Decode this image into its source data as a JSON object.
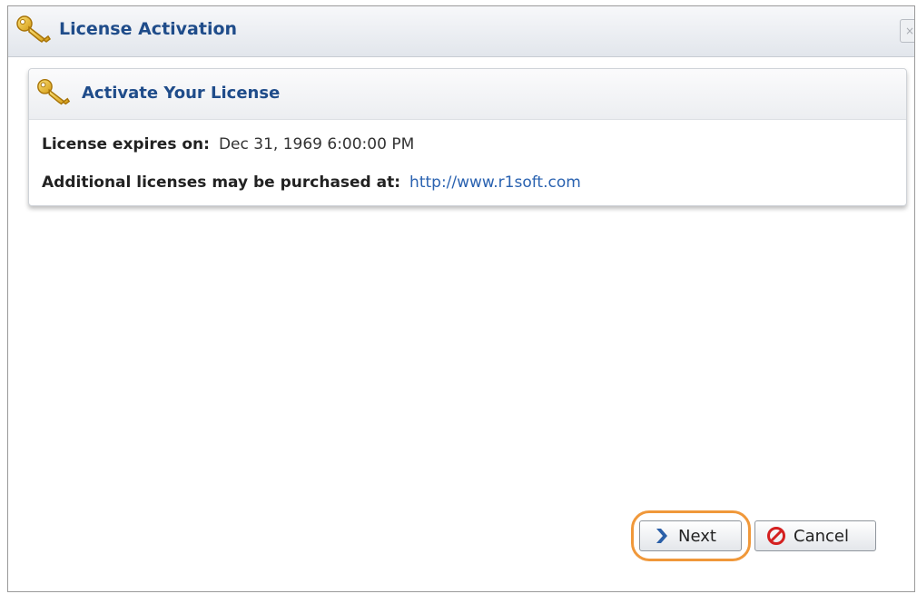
{
  "dialog": {
    "title": "License Activation",
    "title_icon": "key-icon",
    "close_icon": "close-icon",
    "close_glyph": "×"
  },
  "panel": {
    "title": "Activate Your License",
    "title_icon": "key-icon",
    "expires_label": "License expires on:",
    "expires_value": "Dec 31, 1969 6:00:00 PM",
    "purchase_label": "Additional licenses may be purchased at:",
    "purchase_link": "http://www.r1soft.com"
  },
  "buttons": {
    "next_label": "Next",
    "next_icon": "chevron-right-icon",
    "cancel_label": "Cancel",
    "cancel_icon": "cancel-icon"
  },
  "colors": {
    "title_blue": "#1f4c8a",
    "link_blue": "#2a62b0",
    "highlight_orange": "#f0983a",
    "cancel_red": "#d42020",
    "next_blue": "#2a5fa8"
  }
}
